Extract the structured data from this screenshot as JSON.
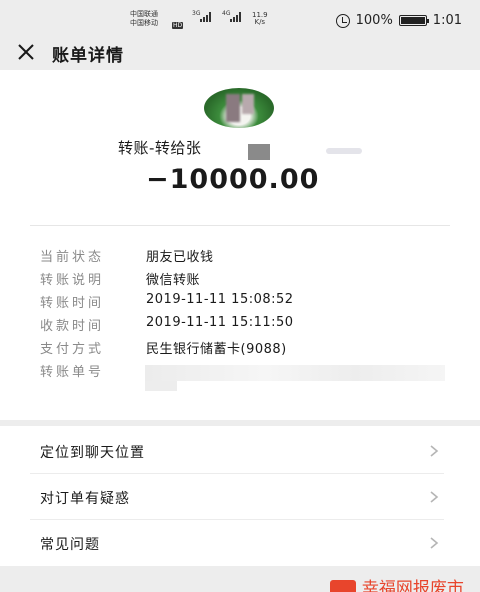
{
  "status_bar": {
    "carrier_1": "中国联通",
    "carrier_2": "中国移动",
    "net_1": "3G",
    "net_2": "4G",
    "hd": "HD",
    "speed_value": "11.9",
    "speed_unit": "K/s",
    "battery": "100%",
    "time": "1:01",
    "icons": [
      "signal-icon",
      "alarm-icon",
      "battery-icon"
    ]
  },
  "header": {
    "title": "账单详情",
    "close_icon": "close-icon"
  },
  "detail": {
    "payee": "转账-转给张",
    "amount": "−10000.00",
    "rows": [
      {
        "label": "当前状态",
        "value": "朋友已收钱"
      },
      {
        "label": "转账说明",
        "value": "微信转账"
      },
      {
        "label": "转账时间",
        "value": "2019-11-11 15:08:52"
      },
      {
        "label": "收款时间",
        "value": "2019-11-11 15:11:50"
      },
      {
        "label": "支付方式",
        "value": "民生银行储蓄卡(9088)"
      },
      {
        "label": "转账单号",
        "value": ""
      }
    ]
  },
  "menu": {
    "items": [
      {
        "label": "定位到聊天位置",
        "icon": "chevron-right-icon"
      },
      {
        "label": "对订单有疑惑",
        "icon": "chevron-right-icon"
      },
      {
        "label": "常见问题",
        "icon": "chevron-right-icon"
      }
    ]
  },
  "watermark": {
    "text": "幸福网报废市场"
  },
  "colors": {
    "background": "#ededed",
    "card": "#ffffff",
    "label_gray": "#8a8a8a",
    "watermark_red": "#e8452c"
  }
}
